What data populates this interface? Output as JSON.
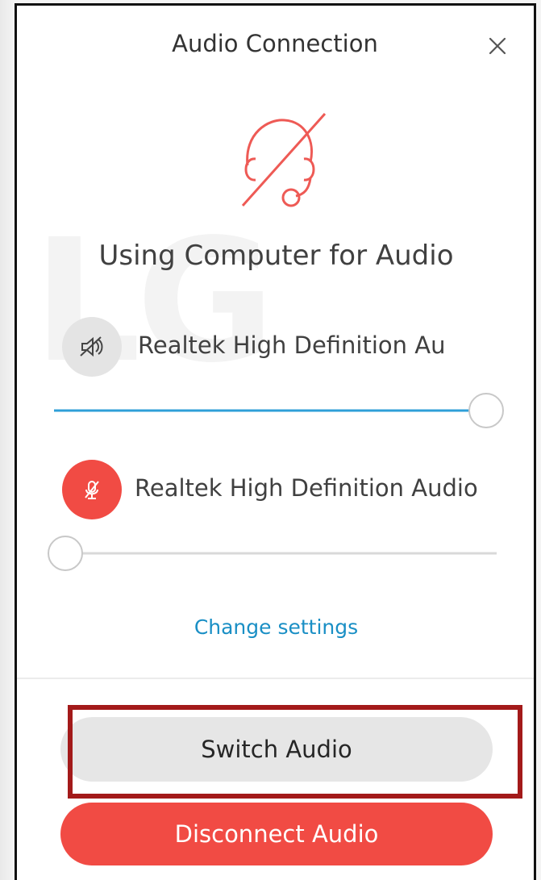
{
  "dialog": {
    "title": "Audio Connection",
    "close_icon": "close-icon",
    "status_icon": "headset-off-icon",
    "status_text": "Using Computer for Audio"
  },
  "speaker": {
    "icon": "speaker-muted-icon",
    "device_name": "Realtek High Definition Au",
    "volume_percent": 100
  },
  "microphone": {
    "icon": "microphone-muted-icon",
    "device_name": "Realtek High Definition Audio",
    "volume_percent": 0
  },
  "links": {
    "change_settings": "Change settings"
  },
  "buttons": {
    "switch_audio": "Switch Audio",
    "disconnect_audio": "Disconnect Audio"
  },
  "colors": {
    "accent_blue": "#2f9fd8",
    "danger_red": "#f14b44",
    "highlight_frame": "#a31a1a"
  }
}
